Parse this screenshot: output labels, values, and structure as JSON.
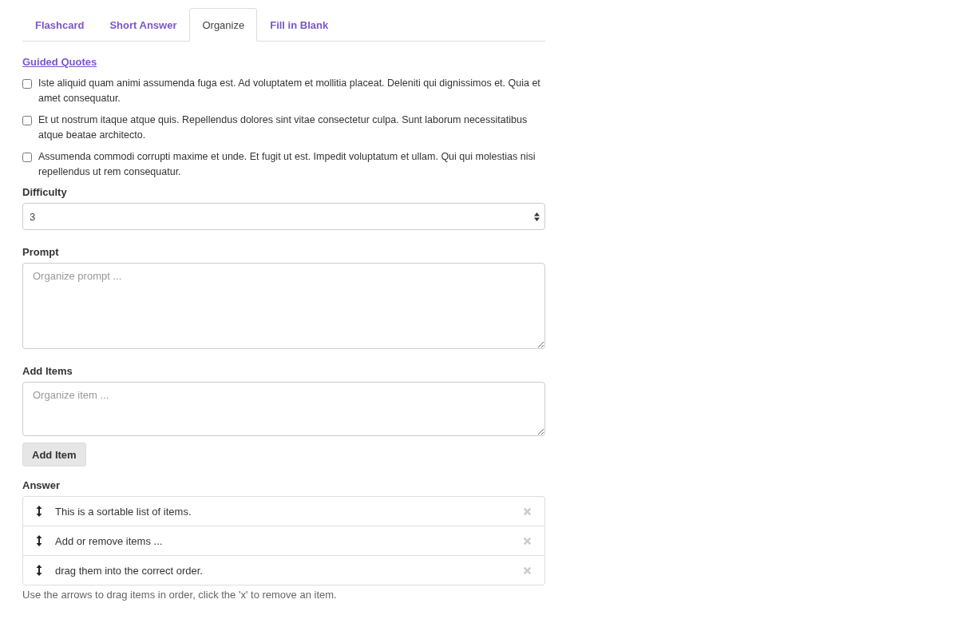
{
  "tabs": [
    {
      "label": "Flashcard",
      "selected": false
    },
    {
      "label": "Short Answer",
      "selected": false
    },
    {
      "label": "Organize",
      "selected": true
    },
    {
      "label": "Fill in Blank",
      "selected": false
    }
  ],
  "guided_quotes": {
    "link": "Guided Quotes",
    "quotes": [
      {
        "text": "Iste aliquid quam animi assumenda fuga est. Ad voluptatem et mollitia placeat. Deleniti qui dignissimos et. Quia et amet consequatur.",
        "checked": false
      },
      {
        "text": "Et ut nostrum itaque atque quis. Repellendus dolores sint vitae consectetur culpa. Sunt laborum necessitatibus atque beatae architecto.",
        "checked": false
      },
      {
        "text": "Assumenda commodi corrupti maxime et unde. Et fugit ut est. Impedit voluptatum et ullam. Qui qui molestias nisi repellendus ut rem consequatur.",
        "checked": false
      }
    ]
  },
  "difficulty": {
    "label": "Difficulty",
    "value": "3"
  },
  "prompt": {
    "label": "Prompt",
    "placeholder": "Organize prompt ..."
  },
  "add_items": {
    "label": "Add Items",
    "placeholder": "Organize item ...",
    "button": "Add Item"
  },
  "answer": {
    "label": "Answer",
    "items": [
      {
        "text": "This is a sortable list of items."
      },
      {
        "text": "Add or remove items ..."
      },
      {
        "text": "drag them into the correct order."
      }
    ],
    "help": "Use the arrows to drag items in order, click the 'x' to remove an item."
  }
}
